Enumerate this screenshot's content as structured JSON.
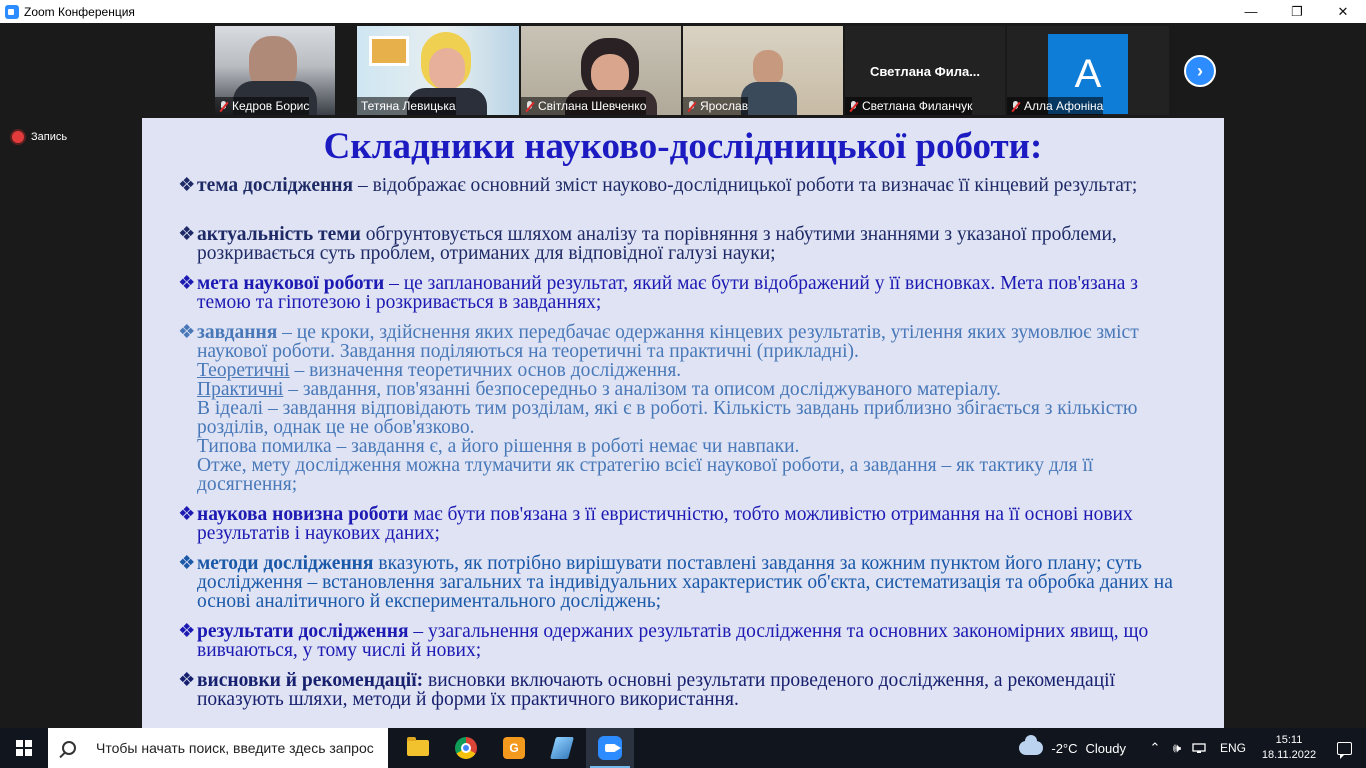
{
  "window": {
    "title": "Zoom Конференция",
    "minimize": "—",
    "maximize": "❐",
    "close": "✕"
  },
  "participants": [
    {
      "name": "Кедров Борис",
      "muted": true,
      "video": true
    },
    {
      "name": "Тетяна Левицька",
      "muted": false,
      "video": true,
      "speaking": true
    },
    {
      "name": "Світлана Шевченко",
      "muted": true,
      "video": true
    },
    {
      "name": "Ярослав",
      "muted": true,
      "video": true
    },
    {
      "name": "Светлана Филанчук",
      "display_name": "Светлана  Фила...",
      "muted": true,
      "video": false
    },
    {
      "name": "Алла Афоніна",
      "muted": true,
      "video": false,
      "avatar_letter": "A"
    }
  ],
  "next_page": "›",
  "recording": {
    "label": "Запись"
  },
  "slide": {
    "title": "Складники науково-дослідницької роботи:",
    "bullet": "❖",
    "items": [
      {
        "term": "тема дослідження",
        "text": " – відображає основний зміст науково-дослідницької роботи та визначає її кінцевий результат;"
      },
      {
        "term": "актуальність теми",
        "text": " обгрунтовується шляхом аналізу та порівняння з набутими знаннями з указаної проблеми, розкривається суть проблем, отриманих для відповідної галузі науки;"
      },
      {
        "term": "мета наукової роботи",
        "text": " – це запланований результат, який має бути відображений у її висновках. Мета пов'язана з темою та гіпотезою і розкривається в завданнях;"
      },
      {
        "term": "завдання",
        "text": " – це кроки, здійснення яких передбачає одержання кінцевих результатів, утілення яких зумовлює зміст наукової роботи. Завдання поділяються на теоретичні та практичні (прикладні).",
        "sub": [
          {
            "u": "Теоретичні",
            "t": " – визначення теоретичних основ дослідження."
          },
          {
            "u": "Практичні",
            "t": " – завдання, пов'язанні безпосередньо з аналізом та описом досліджуваного матеріалу."
          },
          {
            "u": "",
            "t": "В ідеалі – завдання відповідають тим розділам, які є в роботі. Кількість завдань приблизно збігається з кількістю розділів, однак це не обов'язково."
          },
          {
            "u": "",
            "t": "Типова помилка – завдання є, а його рішення в роботі немає чи навпаки."
          },
          {
            "u": "",
            "t": "Отже, мету дослідження можна тлумачити як стратегію всієї наукової роботи, а завдання – як тактику для її досягнення;"
          }
        ]
      },
      {
        "term": "наукова новизна роботи",
        "text": " має бути пов'язана з її евристичністю, тобто можливістю отримання на її основі нових результатів і наукових даних;"
      },
      {
        "term": "методи дослідження",
        "text": " вказують, як потрібно вирішувати поставлені завдання за кожним пунктом його плану;  суть дослідження – встановлення загальних та індивідуальних характеристик об'єкта, систематизація та обробка даних на основі аналітичного й експериментального досліджень;"
      },
      {
        "term": "результати дослідження",
        "text": " – узагальнення одержаних результатів дослідження та основних закономірних явищ, що вивчаються, у тому числі й нових;"
      },
      {
        "term": "висновки й рекомендації:",
        "text": " висновки включають основні результати проведеного дослідження, а рекомендації показують шляхи, методи й форми їх практичного використання."
      }
    ]
  },
  "taskbar": {
    "search_placeholder": "Чтобы начать поиск, введите здесь запрос",
    "apps": [
      "file-explorer",
      "chrome",
      "pdf-reader",
      "app",
      "zoom"
    ],
    "orange_app_label": "G",
    "weather": {
      "temp": "-2°C",
      "condition": "Cloudy"
    },
    "tray_up": "⌃",
    "volume": "🕪",
    "language": "ENG",
    "time": "15:11",
    "date": "18.11.2022"
  }
}
